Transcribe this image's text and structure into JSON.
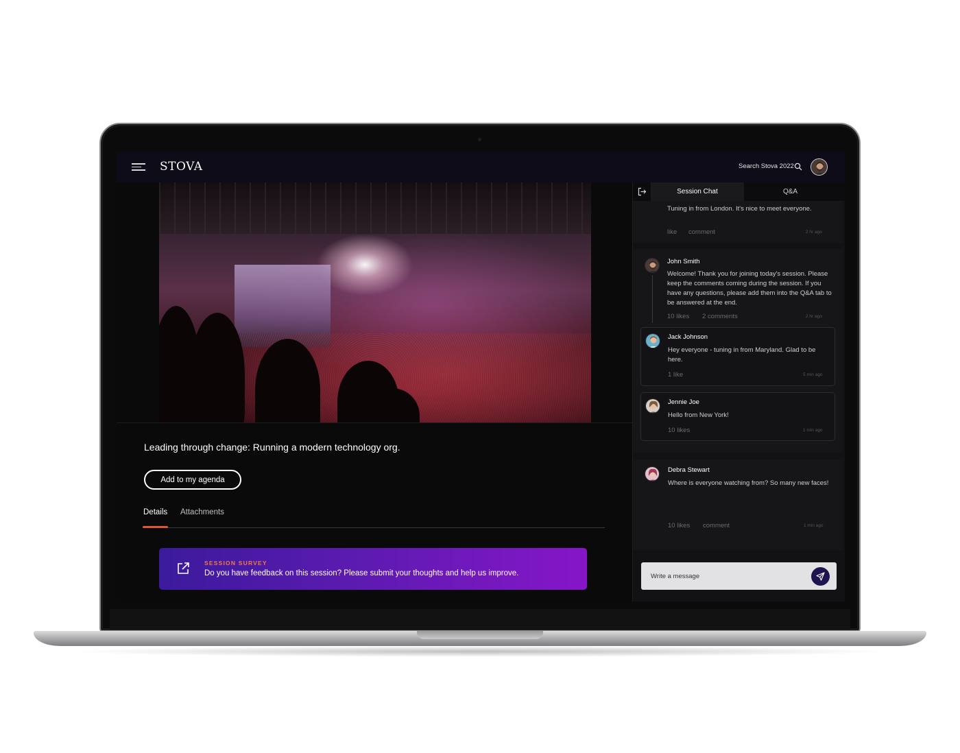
{
  "header": {
    "logo": "STOVA",
    "search_label": "Search Stova 2022"
  },
  "session": {
    "title": "Leading through change: Running a modern technology org.",
    "agenda_button": "Add to my agenda",
    "tabs": [
      {
        "label": "Details",
        "active": true
      },
      {
        "label": "Attachments",
        "active": false
      }
    ],
    "survey": {
      "kicker": "SESSION SURVEY",
      "text": "Do you have feedback on this session? Please submit your thoughts and help us improve."
    }
  },
  "chat": {
    "tabs": [
      {
        "label": "Session Chat",
        "active": true
      },
      {
        "label": "Q&A",
        "active": false
      }
    ],
    "messages": [
      {
        "name": "",
        "text": "Tuning in from London. It's nice to meet everyone.",
        "actions": [
          "like",
          "comment"
        ],
        "time": "2 hr ago"
      },
      {
        "name": "John Smith",
        "text": "Welcome! Thank you for joining today's session. Please keep the comments coming during the session. If you have any questions, please add them into the Q&A tab to be answered at the end.",
        "actions": [
          "10 likes",
          "2 comments"
        ],
        "time": "2 hr ago"
      },
      {
        "name": "Jack Johnson",
        "text": "Hey everyone - tuning in from Maryland. Glad to be here.",
        "actions": [
          "1 like"
        ],
        "time": "5 min ago"
      },
      {
        "name": "Jennie Joe",
        "text": "Hello from New York!",
        "actions": [
          "10 likes"
        ],
        "time": "1 min ago"
      },
      {
        "name": "Debra Stewart",
        "text": "Where is everyone watching from? So many new faces!",
        "actions": [
          "10 likes",
          "comment"
        ],
        "time": "1 min ago"
      }
    ],
    "composer_placeholder": "Write a message"
  },
  "colors": {
    "accent_orange": "#e4572e",
    "survey_gradient_start": "#3b1a9c",
    "survey_gradient_end": "#8616c8",
    "send_button": "#1e1450"
  },
  "icons": [
    "menu-icon",
    "search-icon",
    "exit-icon",
    "external-link-icon",
    "send-icon"
  ]
}
